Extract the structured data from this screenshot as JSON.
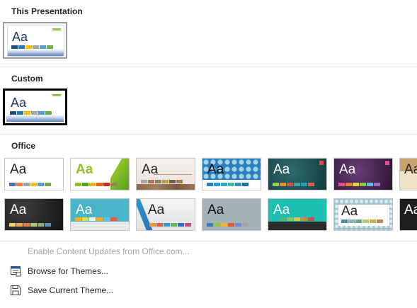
{
  "sections": {
    "this_presentation": "This Presentation",
    "custom": "Custom",
    "office": "Office"
  },
  "menu": {
    "enable_updates": "Enable Content Updates from Office.com...",
    "browse": "Browse for Themes...",
    "save": "Save Current Theme..."
  },
  "theme_label": "Aa",
  "swatches": {
    "office": [
      "#4472c4",
      "#ed7d31",
      "#a5a5a5",
      "#ffc000",
      "#5b9bd5",
      "#70ad47"
    ],
    "custom": [
      "#1f4e79",
      "#2e75b6",
      "#ffc000",
      "#a5a5a5",
      "#5b9bd5",
      "#70ad47"
    ],
    "facet": [
      "#90c226",
      "#54a021",
      "#e6b91e",
      "#e76618",
      "#c42f1a",
      "#918655"
    ],
    "retro": [
      "#a6a6a6",
      "#b5704c",
      "#8c8356",
      "#c49a3a",
      "#6e5f53",
      "#ab7942"
    ],
    "pattern": [
      "#2c7fb8",
      "#2a9dd0",
      "#37a8b5",
      "#4eb3a1",
      "#3a8fbd",
      "#1f6f9f"
    ],
    "teal": [
      "#a4c648",
      "#ef8b1e",
      "#e6474b",
      "#3aa5a2",
      "#21a1c2",
      "#ea5a46"
    ],
    "purple": [
      "#e04f90",
      "#e87e3e",
      "#f2c849",
      "#8fc641",
      "#5ebbe4",
      "#a164c8"
    ],
    "dark": [
      "#f4d35e",
      "#f6a541",
      "#e77f3f",
      "#b9c873",
      "#87b37a",
      "#5a93c4"
    ],
    "cyan": [
      "#f4ae1e",
      "#d8e04f",
      "#f3f3f3",
      "#f4ae1e",
      "#5bc1e4",
      "#e85a42"
    ],
    "ribbon": [
      "#f0942b",
      "#ea5a46",
      "#2e9ad0",
      "#5dbb54",
      "#2a6eb5",
      "#c84a83"
    ],
    "slate": [
      "#4a72b2",
      "#8dc353",
      "#f3b43b",
      "#d5593d",
      "#6c8ec7",
      "#a3a3a3"
    ],
    "mint": [
      "#1cbfb2",
      "#56b870",
      "#8ac84e",
      "#e9c23d",
      "#ec7c2f",
      "#d94a4a"
    ],
    "lattice": [
      "#4f8fa6",
      "#83b3b8",
      "#74a48f",
      "#b9c87c",
      "#ccad5c",
      "#b88664"
    ]
  }
}
